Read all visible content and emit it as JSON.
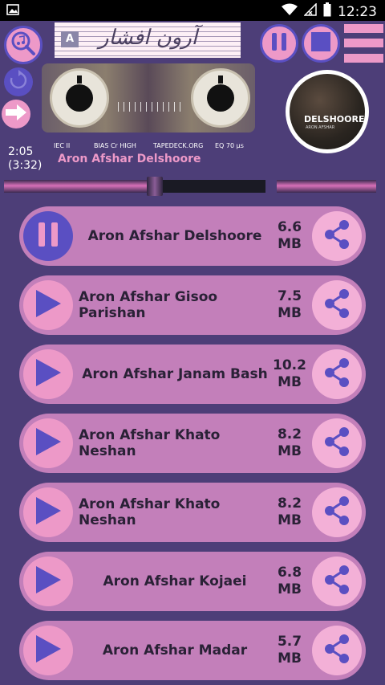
{
  "status_bar": {
    "time": "12:23"
  },
  "cassette": {
    "label_letter": "A",
    "label_script": "آرون افشار",
    "iec": "IEC II",
    "bias": "BIAS Cr HIGH",
    "brand": "TAPEDECK.ORG",
    "eq": "EQ 70 µs"
  },
  "player": {
    "elapsed": "2:05",
    "duration": "(3:32)",
    "now_playing": "Aron Afshar Delshoore",
    "progress": 0.41
  },
  "album": {
    "title": "DELSHOOREH",
    "subtitle": "ARON AFSHAR"
  },
  "tracks": [
    {
      "title": "Aron Afshar Delshoore",
      "size_num": "6.6",
      "size_unit": "MB",
      "playing": true
    },
    {
      "title": "Aron Afshar Gisoo Parishan",
      "size_num": "7.5",
      "size_unit": "MB",
      "playing": false
    },
    {
      "title": "Aron Afshar Janam Bash",
      "size_num": "10.2",
      "size_unit": "MB",
      "playing": false
    },
    {
      "title": "Aron Afshar Khato Neshan",
      "size_num": "8.2",
      "size_unit": "MB",
      "playing": false
    },
    {
      "title": "Aron Afshar Khato Neshan",
      "size_num": "8.2",
      "size_unit": "MB",
      "playing": false
    },
    {
      "title": "Aron Afshar Kojaei",
      "size_num": "6.8",
      "size_unit": "MB",
      "playing": false
    },
    {
      "title": "Aron Afshar Madar",
      "size_num": "5.7",
      "size_unit": "MB",
      "playing": false
    }
  ],
  "colors": {
    "background": "#4d3e78",
    "pink": "#ed99c8",
    "row": "#c37fba",
    "blue_violet": "#5a4fc2"
  }
}
